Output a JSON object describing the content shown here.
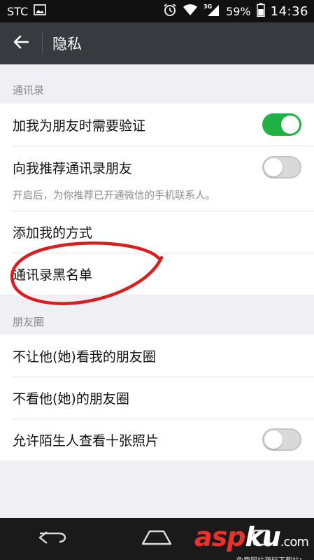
{
  "status_bar": {
    "carrier": "STC",
    "signal_label": "3G",
    "battery": "59%",
    "time": "14:36"
  },
  "header": {
    "title": "隐私"
  },
  "sections": {
    "contacts": {
      "title": "通讯录",
      "rows": {
        "verify": {
          "label": "加我为朋友时需要验证",
          "switch": "on"
        },
        "recommend": {
          "label": "向我推荐通讯录朋友",
          "desc": "开启后，为你推荐已开通微信的手机联系人。",
          "switch": "off"
        },
        "add_methods": {
          "label": "添加我的方式"
        },
        "blacklist": {
          "label": "通讯录黑名单"
        }
      }
    },
    "moments": {
      "title": "朋友圈",
      "rows": {
        "block_viewing": {
          "label": "不让他(她)看我的朋友圈"
        },
        "hide_theirs": {
          "label": "不看他(她)的朋友圈"
        },
        "stranger_photos": {
          "label": "允许陌生人查看十张照片",
          "switch": "off"
        }
      }
    }
  },
  "colors": {
    "header_bg": "#393a3f",
    "switch_on": "#1fb144",
    "annotation": "#d81e1e"
  },
  "watermark": {
    "main": "asp",
    "main_b": "ku",
    "suffix": ".com",
    "sub": "免费网站源码下载站!"
  },
  "icons": {
    "back": "arrow-left-icon",
    "nav_back": "nav-back-icon",
    "nav_home": "nav-home-icon",
    "nav_recent": "nav-recent-icon"
  }
}
